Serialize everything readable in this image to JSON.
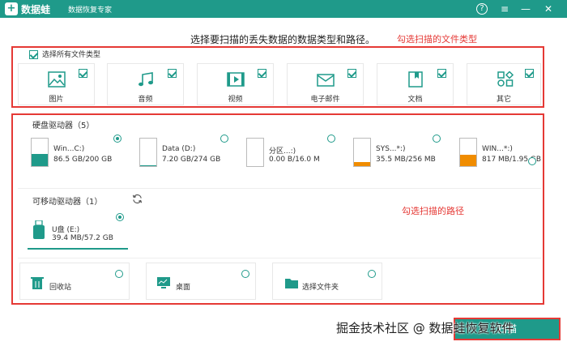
{
  "app": {
    "name": "数据蛙",
    "subtitle": "数据恢复专家",
    "logo_letter": "+"
  },
  "window_controls": {
    "help": "?",
    "menu": "≡",
    "minimize": "—",
    "close": "✕"
  },
  "instruction": "选择要扫描的丢失数据的数据类型和路径。",
  "annotations": {
    "types": "勾选扫描的文件类型",
    "paths": "勾选扫描的路径"
  },
  "file_types": {
    "select_all": "选择所有文件类型",
    "items": [
      {
        "label": "图片",
        "icon": "image-icon",
        "checked": true
      },
      {
        "label": "音频",
        "icon": "music-icon",
        "checked": true
      },
      {
        "label": "视频",
        "icon": "video-icon",
        "checked": true
      },
      {
        "label": "电子邮件",
        "icon": "email-icon",
        "checked": true
      },
      {
        "label": "文档",
        "icon": "document-icon",
        "checked": true
      },
      {
        "label": "其它",
        "icon": "other-icon",
        "checked": true
      }
    ]
  },
  "hard_drives": {
    "title": "硬盘驱动器（5）",
    "items": [
      {
        "name": "Win...C:)",
        "size": "86.5 GB/200 GB",
        "used_fraction": 0.43,
        "color": "#1f9a8a",
        "selected": true
      },
      {
        "name": "Data (D:)",
        "size": "7.20 GB/274 GB",
        "used_fraction": 0.03,
        "color": "#1f9a8a",
        "selected": false
      },
      {
        "name": "分区...:)",
        "size": "0.00  B/16.0 M",
        "used_fraction": 0.0,
        "color": "#1f9a8a",
        "selected": false
      },
      {
        "name": "SYS...*:)",
        "size": "35.5 MB/256 MB",
        "used_fraction": 0.14,
        "color": "#f08c00",
        "selected": false
      },
      {
        "name": "WIN...*:)",
        "size": "817 MB/1.95 GB",
        "used_fraction": 0.42,
        "color": "#f08c00",
        "selected": false
      }
    ]
  },
  "removable": {
    "title": "可移动驱动器（1）",
    "refresh_icon": "refresh-icon",
    "items": [
      {
        "name": "U盘 (E:)",
        "size": "39.4 MB/57.2 GB",
        "selected": true
      }
    ]
  },
  "locations": [
    {
      "label": "回收站",
      "icon": "recycle-bin-icon"
    },
    {
      "label": "桌面",
      "icon": "desktop-icon"
    },
    {
      "label": "选择文件夹",
      "icon": "folder-icon"
    }
  ],
  "scan_button": "扫描",
  "watermark": "掘金技术社区 @ 数据蛙恢复软件",
  "colors": {
    "accent": "#1f9a8a",
    "annotation": "#e53935",
    "warning": "#f08c00"
  }
}
